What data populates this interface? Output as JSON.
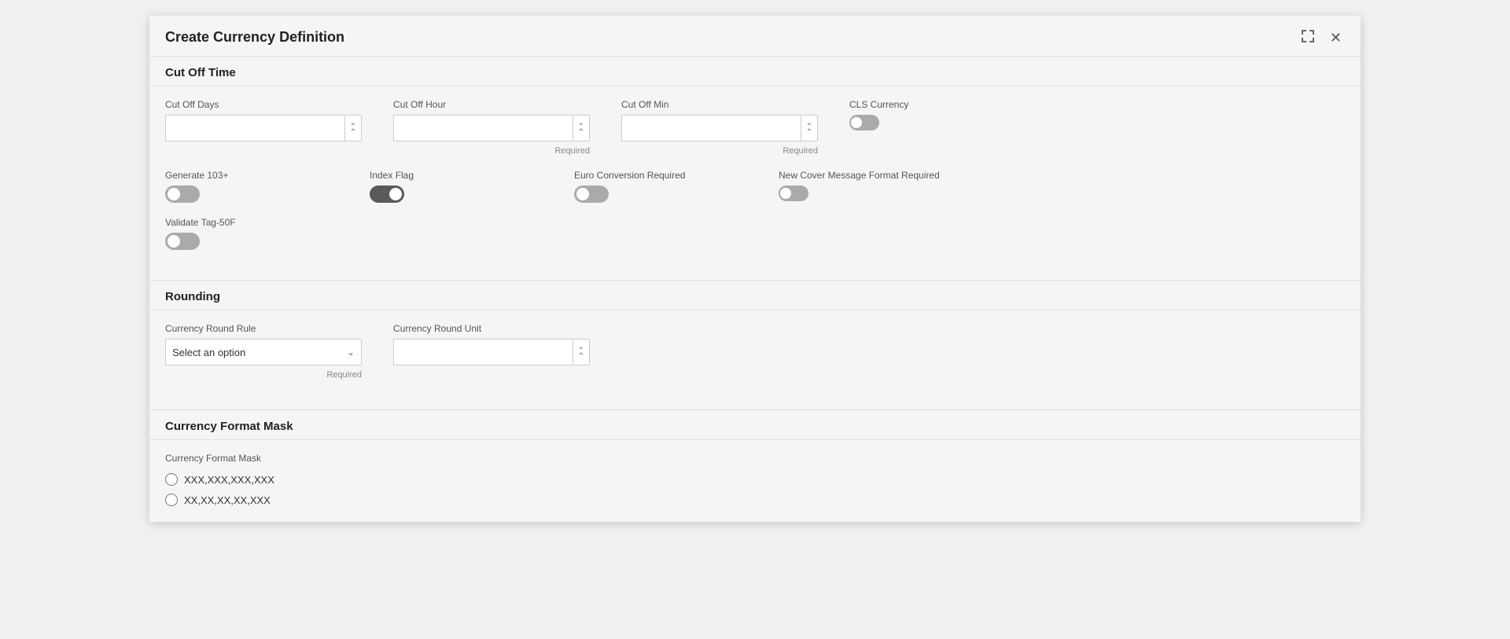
{
  "modal": {
    "title": "Create Currency Definition",
    "expand_icon": "⤢",
    "close_icon": "✕"
  },
  "sections": {
    "cut_off_time": {
      "label": "Cut Off Time",
      "fields": {
        "cut_off_days": {
          "label": "Cut Off Days",
          "placeholder": "",
          "required": false
        },
        "cut_off_hour": {
          "label": "Cut Off Hour",
          "placeholder": "",
          "required": true,
          "required_text": "Required"
        },
        "cut_off_min": {
          "label": "Cut Off Min",
          "placeholder": "",
          "required": true,
          "required_text": "Required"
        },
        "cls_currency": {
          "label": "CLS Currency"
        },
        "generate_103": {
          "label": "Generate 103+"
        },
        "index_flag": {
          "label": "Index Flag",
          "checked": true
        },
        "euro_conversion": {
          "label": "Euro Conversion Required"
        },
        "new_cover_msg": {
          "label": "New Cover Message Format Required"
        },
        "validate_tag50f": {
          "label": "Validate Tag-50F"
        }
      }
    },
    "rounding": {
      "label": "Rounding",
      "fields": {
        "currency_round_rule": {
          "label": "Currency Round Rule",
          "placeholder": "Select an option",
          "required": true,
          "required_text": "Required"
        },
        "currency_round_unit": {
          "label": "Currency Round Unit",
          "placeholder": "",
          "required": false
        }
      }
    },
    "currency_format_mask": {
      "label": "Currency Format Mask",
      "sub_label": "Currency Format Mask",
      "options": [
        {
          "value": "option1",
          "label": "XXX,XXX,XXX,XXX"
        },
        {
          "value": "option2",
          "label": "XX,XX,XX,XX,XXX"
        }
      ]
    }
  }
}
